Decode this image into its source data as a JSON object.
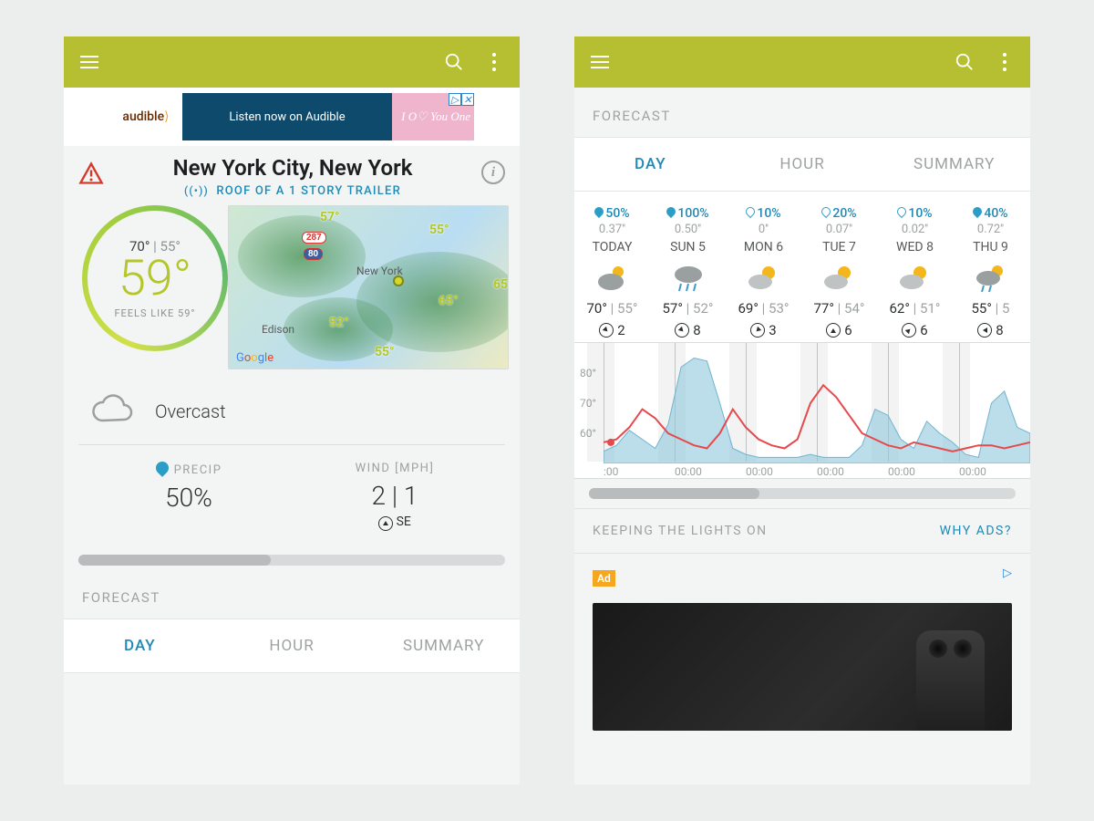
{
  "appbar": {
    "menu": "menu",
    "search": "search",
    "more": "more"
  },
  "ad_banner": {
    "brand": "audible",
    "cta": "Listen now on Audible",
    "promo": "I O♡ You One"
  },
  "location": {
    "title": "New York City, New York",
    "station": "ROOF OF A 1 STORY TRAILER"
  },
  "now": {
    "high": "70°",
    "low": "55°",
    "temp": "59°",
    "feels_label": "FEELS LIKE 59°",
    "condition": "Overcast"
  },
  "stats": {
    "precip_label": "PRECIP",
    "precip_value": "50%",
    "wind_label": "WIND [MPH]",
    "wind_value": "2 | 1",
    "wind_dir": "SE"
  },
  "forecast_label": "FORECAST",
  "tabs": {
    "day": "DAY",
    "hour": "HOUR",
    "summary": "SUMMARY"
  },
  "lights": {
    "left": "KEEPING THE LIGHTS ON",
    "right": "WHY ADS?"
  },
  "ad2": {
    "badge": "Ad"
  },
  "daily": [
    {
      "precip_pct": "50%",
      "drop": "full",
      "amount": "0.37''",
      "name": "TODAY",
      "icon": "cloud-sun",
      "hi": "70°",
      "lo": "55°",
      "wind": "2",
      "rot": 135
    },
    {
      "precip_pct": "100%",
      "drop": "full",
      "amount": "0.50''",
      "name": "SUN 5",
      "icon": "rain",
      "hi": "57°",
      "lo": "52°",
      "wind": "8",
      "rot": 135
    },
    {
      "precip_pct": "10%",
      "drop": "empty",
      "amount": "0''",
      "name": "MON 6",
      "icon": "partly",
      "hi": "69°",
      "lo": "53°",
      "wind": "3",
      "rot": 225
    },
    {
      "precip_pct": "20%",
      "drop": "empty",
      "amount": "0.07''",
      "name": "TUE 7",
      "icon": "partly",
      "hi": "77°",
      "lo": "54°",
      "wind": "6",
      "rot": 0
    },
    {
      "precip_pct": "10%",
      "drop": "empty",
      "amount": "0.02''",
      "name": "WED 8",
      "icon": "partly",
      "hi": "62°",
      "lo": "51°",
      "wind": "6",
      "rot": 45
    },
    {
      "precip_pct": "40%",
      "drop": "full",
      "amount": "0.72''",
      "name": "THU 9",
      "icon": "rain-sun",
      "hi": "55°",
      "lo": "5",
      "wind": "8",
      "rot": 270
    }
  ],
  "chart_data": {
    "type": "line",
    "ylabel": "°F",
    "ylim": [
      50,
      90
    ],
    "yticks": [
      60,
      70,
      80
    ],
    "xlabels": [
      ":00",
      "00:00",
      "00:00",
      "00:00",
      "00:00",
      "00:00"
    ],
    "series": [
      {
        "name": "temperature_red",
        "color": "#e6494c",
        "values": [
          57,
          58,
          62,
          68,
          65,
          60,
          58,
          56,
          55,
          60,
          68,
          62,
          58,
          56,
          55,
          58,
          70,
          76,
          72,
          66,
          60,
          58,
          56,
          55,
          57,
          56,
          55,
          54,
          55,
          56,
          56,
          55,
          56,
          57
        ]
      },
      {
        "name": "precip_blue_area",
        "color": "#8fc6dc",
        "values": [
          54,
          56,
          61,
          58,
          55,
          63,
          82,
          85,
          84,
          70,
          55,
          53,
          52,
          52,
          52,
          52,
          53,
          52,
          52,
          52,
          56,
          68,
          66,
          58,
          55,
          64,
          60,
          57,
          53,
          52,
          70,
          74,
          62,
          60
        ]
      }
    ]
  }
}
